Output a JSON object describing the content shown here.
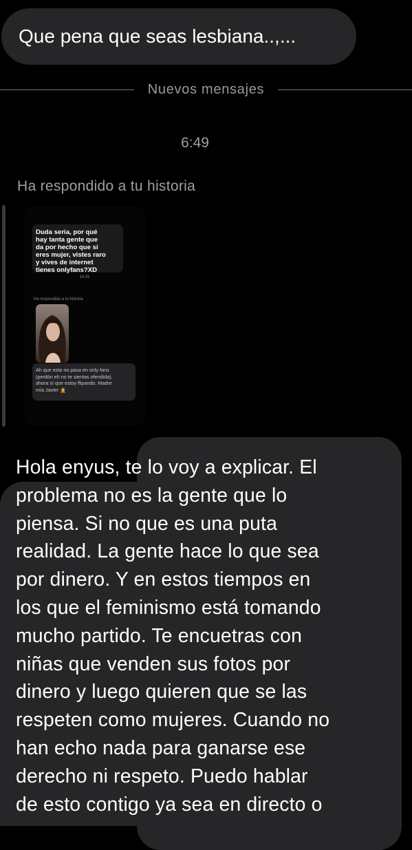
{
  "messages": {
    "sent_top": "Que pena que seas lesbiana..,...",
    "new_messages_label": "Nuevos mensajes",
    "time": "6:49",
    "replied_story_label": "Ha respondido a tu historia",
    "reply_body": "Hola  enyus, te lo voy a explicar. El\nproblema no es la gente que lo\npiensa. Si no que es una puta\nrealidad. La gente hace lo que sea\npor dinero. Y en estos tiempos en\nlos que el feminismo está tomando\nmucho partido. Te encuetras con\nniñas que venden sus fotos por\ndinero y luego quieren que se las\nrespeten como mujeres. Cuando no\nhan echo nada para ganarse ese\nderecho ni respeto. Puedo hablar\nde esto contigo ya sea en directo o"
  },
  "story": {
    "question_text": "Duda seria, por qué\nhay tanta gente que\nda por hecho que si\neres mujer, vistes raro\ny vives de internet\ntienes onlyfans?XD",
    "time": "14:31",
    "replied_label": "Ha respondido a tu historia",
    "reply_text": "Ah que esto no pasa en only fans\n(perdón eh no te sientas ofendida),\nahora sí que estoy flipando. Madre\nmía Javier 🤦"
  },
  "colors": {
    "background": "#000000",
    "bubble": "#262628",
    "secondary_text": "#a0a0a4",
    "primary_text": "#ffffff"
  }
}
